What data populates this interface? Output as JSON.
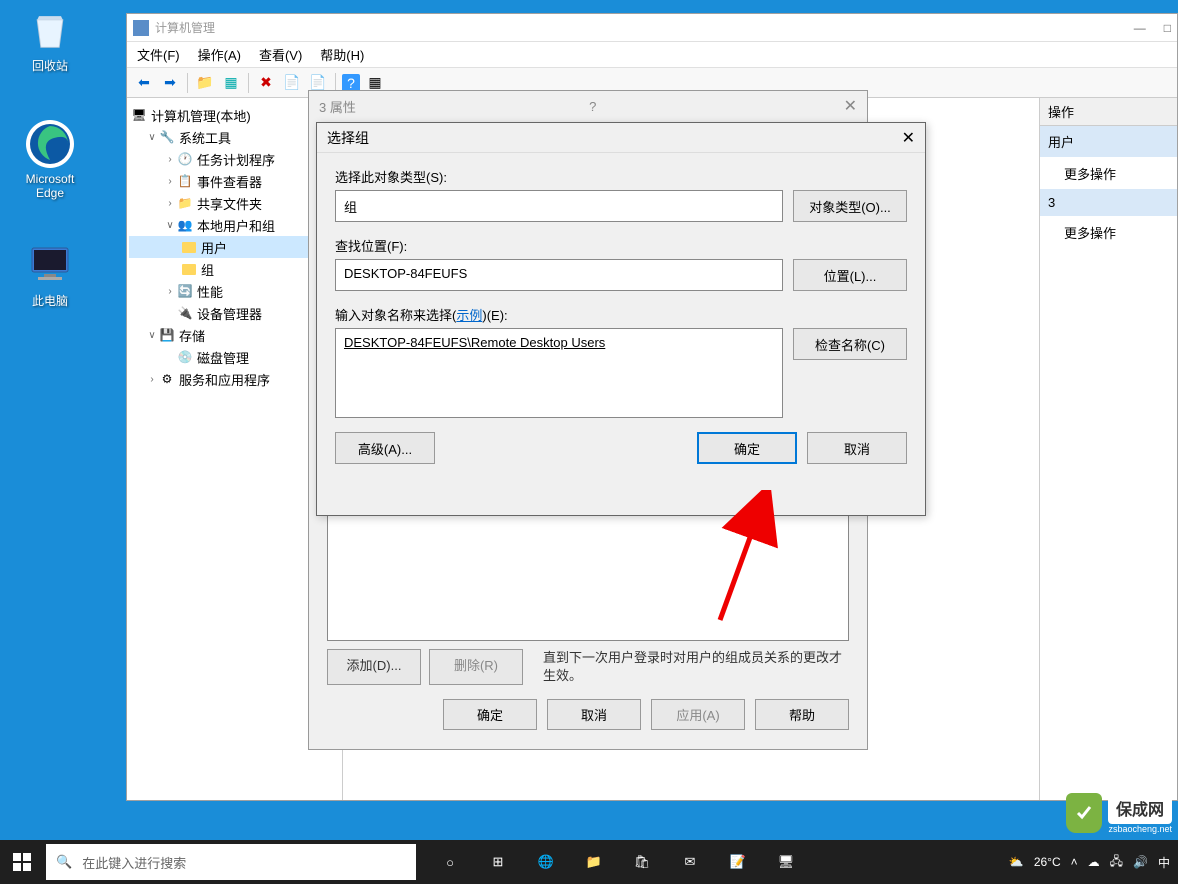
{
  "desktop": {
    "recycle_bin": "回收站",
    "edge": "Microsoft Edge",
    "this_pc": "此电脑"
  },
  "window": {
    "title": "计算机管理",
    "menu": {
      "file": "文件(F)",
      "action": "操作(A)",
      "view": "查看(V)",
      "help": "帮助(H)"
    }
  },
  "tree": {
    "root": "计算机管理(本地)",
    "system_tools": "系统工具",
    "task_scheduler": "任务计划程序",
    "event_viewer": "事件查看器",
    "shared_folders": "共享文件夹",
    "local_users": "本地用户和组",
    "users": "用户",
    "groups": "组",
    "performance": "性能",
    "device_manager": "设备管理器",
    "storage": "存储",
    "disk_management": "磁盘管理",
    "services_apps": "服务和应用程序"
  },
  "actions": {
    "header": "操作",
    "item1": "用户",
    "sub1": "更多操作",
    "item2": "3",
    "sub2": "更多操作"
  },
  "props": {
    "title": "3 属性",
    "hint": "直到下一次用户登录时对用户的组成员关系的更改才生效。",
    "add": "添加(D)...",
    "delete": "删除(R)",
    "ok": "确定",
    "cancel": "取消",
    "apply": "应用(A)",
    "help": "帮助"
  },
  "select": {
    "title": "选择组",
    "object_type_label": "选择此对象类型(S):",
    "object_type_value": "组",
    "object_type_btn": "对象类型(O)...",
    "location_label": "查找位置(F):",
    "location_value": "DESKTOP-84FEUFS",
    "location_btn": "位置(L)...",
    "names_label_pre": "输入对象名称来选择(",
    "names_label_link": "示例",
    "names_label_post": ")(E):",
    "names_value": "DESKTOP-84FEUFS\\Remote Desktop Users",
    "check_names": "检查名称(C)",
    "advanced": "高级(A)...",
    "ok": "确定",
    "cancel": "取消"
  },
  "taskbar": {
    "search_placeholder": "在此键入进行搜索",
    "weather": "26°C",
    "lang": "中"
  },
  "watermark": {
    "text": "保成网",
    "sub": "zsbaocheng.net"
  }
}
